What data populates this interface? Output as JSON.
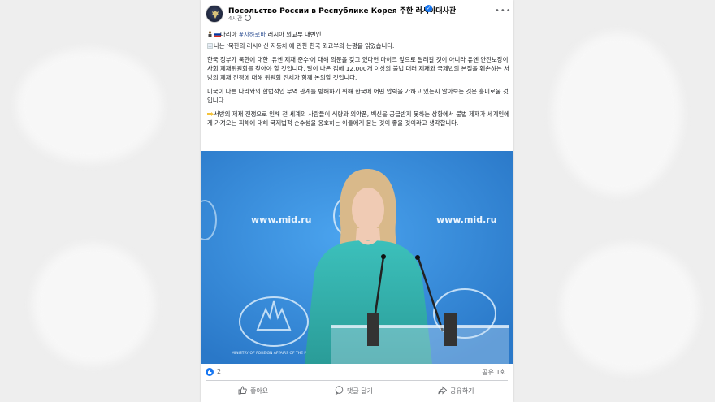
{
  "post": {
    "page_name": "Посольство России в Республике Корея 주한 러시아대사관",
    "time": "4시간",
    "author_line": {
      "name": "마리아",
      "hashtag": "#자하로바",
      "role": "러시아 외교부 대변인"
    },
    "paragraphs": [
      {
        "lead_icon": "memo-icon",
        "text": "나는 '북한의 러시아산 자동차'에 관한 한국 외교부의 논평을 읽었습니다."
      },
      {
        "lead_icon": "",
        "text": "한국 정부가 북한에 대한 '유엔 제재 준수'에 대해 의문을 갖고 있다면 마이크 앞으로 달려갈 것이 아니라 유엔 안전보장이사회 제재위원회를 찾아야 할 것입니다. 말이 나온 김에 12,000개 이상의 불법 대러 제재와 국제법의 본질을 훼손하는 서방의 제재 전쟁에 대해 위원회 전체가 함께 논의할 것입니다."
      },
      {
        "lead_icon": "",
        "text": "미국이 다른 나라와의 합법적인 무역 관계를 방해하기 위해 한국에 어떤 압력을 가하고 있는지 알아보는 것은 흥미로울 것입니다."
      },
      {
        "lead_icon": "point-right-icon",
        "text": "서방의 제재 전쟁으로 인해 전 세계의 사람들이 식량과 의약품, 백신을 공급받지 못하는 상황에서 불법 제재가 세계인에게 가져오는 피해에 대해 국제법적 순수성을 옹호하는 이들에게 묻는 것이 좋을 것이라고 생각합니다."
      }
    ],
    "photo": {
      "backdrop_text": "www.mid.ru",
      "emblem_caption": "MINISTRY OF FOREIGN AFFAIRS OF THE RUSSIAN FEDERATION"
    },
    "reactions": {
      "count": "2",
      "shares": "공유 1회"
    },
    "actions": {
      "like": "좋아요",
      "comment": "댓글 달기",
      "share": "공유하기"
    }
  },
  "colors": {
    "brand_blue": "#1877f2",
    "backdrop_blue": "#3b8fd8",
    "hashtag": "#385898",
    "dress": "#36b4b0"
  }
}
